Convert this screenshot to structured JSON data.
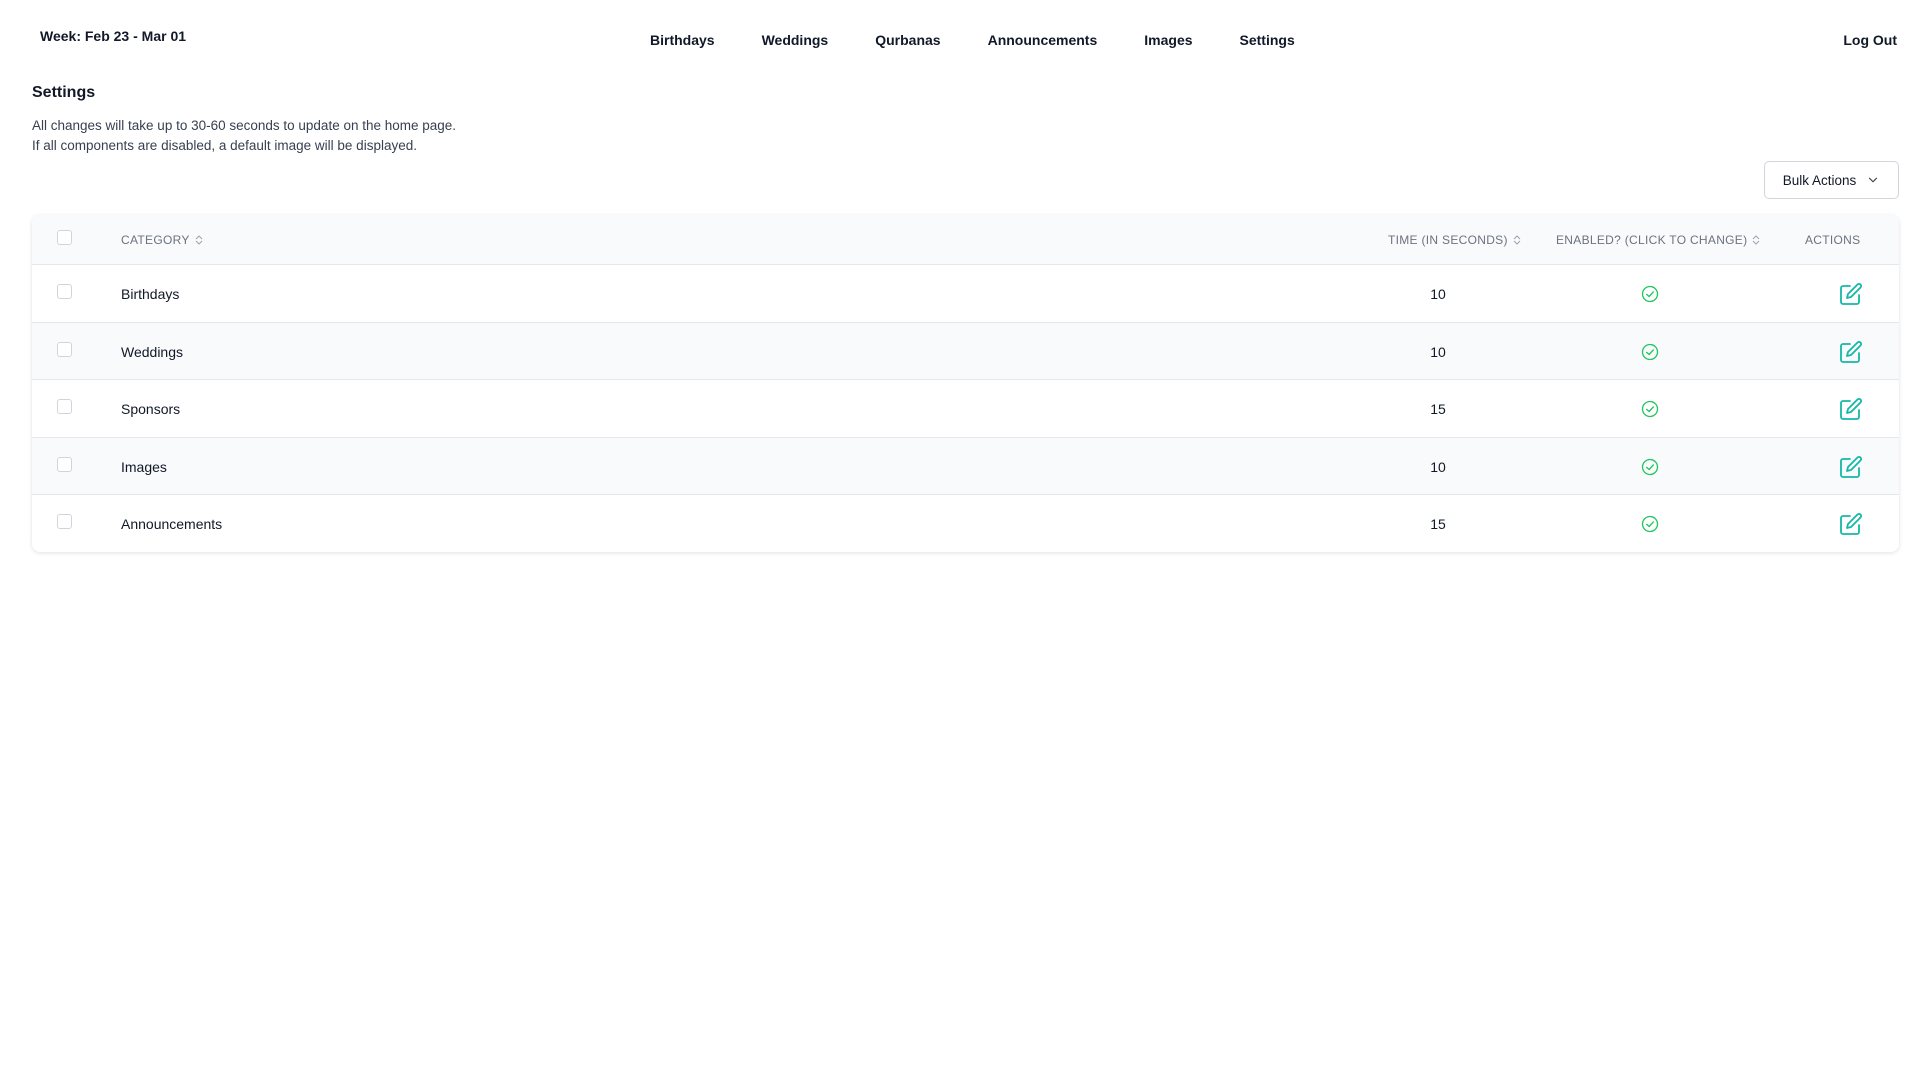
{
  "header": {
    "week_label": "Week: Feb 23 - Mar 01",
    "nav": [
      "Birthdays",
      "Weddings",
      "Qurbanas",
      "Announcements",
      "Images",
      "Settings"
    ],
    "logout_label": "Log Out"
  },
  "page": {
    "title": "Settings",
    "notes": [
      "All changes will take up to 30-60 seconds to update on the home page.",
      "If all components are disabled, a default image will be displayed."
    ]
  },
  "bulk_actions": {
    "label": "Bulk Actions",
    "icon": "chevron-down-icon"
  },
  "table": {
    "columns": {
      "category": "CATEGORY",
      "time": "TIME (IN SECONDS)",
      "enabled": "ENABLED? (CLICK TO CHANGE)",
      "actions": "ACTIONS"
    },
    "rows": [
      {
        "category": "Birthdays",
        "time": "10",
        "enabled": true
      },
      {
        "category": "Weddings",
        "time": "10",
        "enabled": true
      },
      {
        "category": "Sponsors",
        "time": "15",
        "enabled": true
      },
      {
        "category": "Images",
        "time": "10",
        "enabled": true
      },
      {
        "category": "Announcements",
        "time": "15",
        "enabled": true
      }
    ]
  },
  "colors": {
    "enabled_green": "#22c55e",
    "edit_teal": "#14b8a6",
    "text": "#111827",
    "muted": "#6b7280"
  },
  "icons": {
    "enabled": "check-circle-icon",
    "edit": "edit-icon",
    "sort": "sort-icon"
  }
}
